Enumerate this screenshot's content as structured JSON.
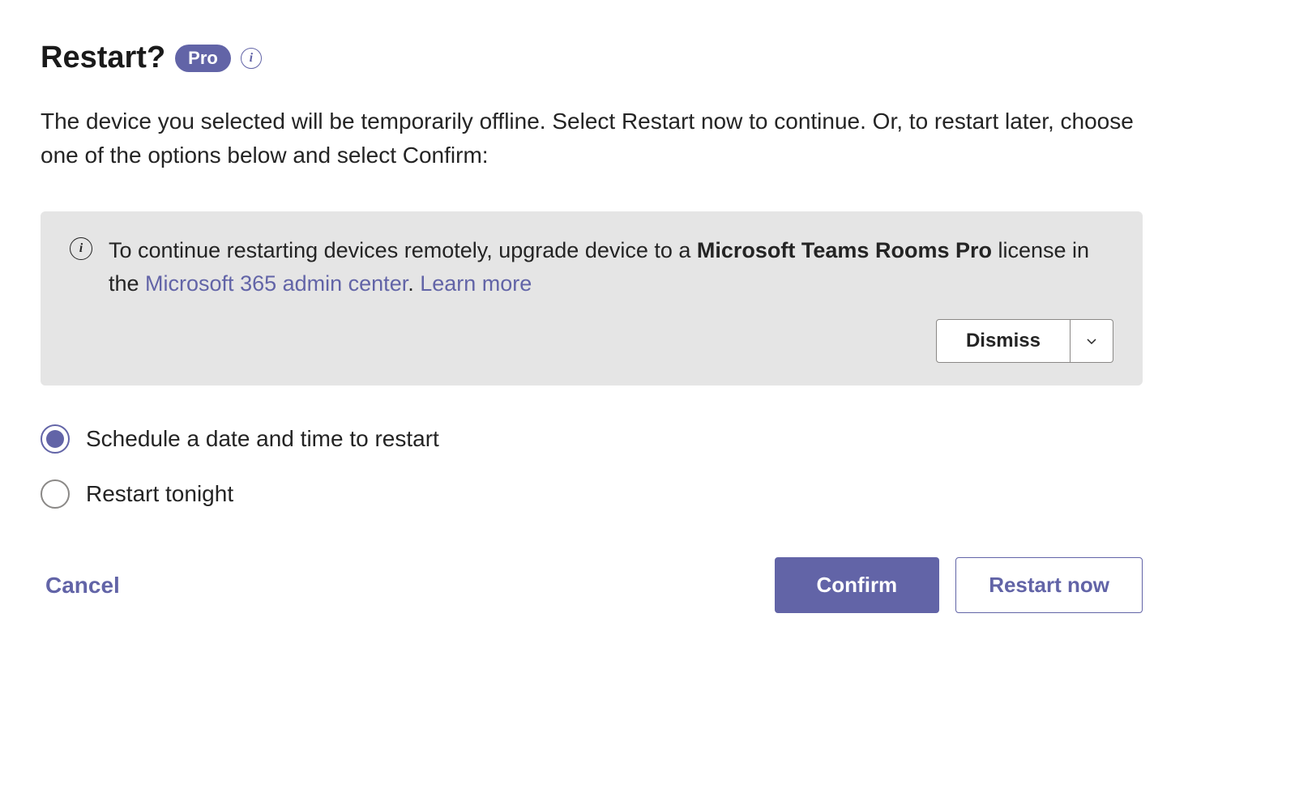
{
  "header": {
    "title": "Restart?",
    "badge": "Pro"
  },
  "description": "The device you selected will be temporarily offline. Select Restart now to continue. Or, to restart later, choose one of the options below and select Confirm:",
  "banner": {
    "text_prefix": "To continue restarting devices remotely, upgrade device to a ",
    "text_bold": "Microsoft Teams Rooms Pro",
    "text_middle": " license in the ",
    "link_admin": "Microsoft 365 admin center",
    "text_period": ". ",
    "link_learn": "Learn more",
    "dismiss_label": "Dismiss"
  },
  "options": {
    "schedule": "Schedule a date and time to restart",
    "tonight": "Restart tonight"
  },
  "footer": {
    "cancel": "Cancel",
    "confirm": "Confirm",
    "restart_now": "Restart now"
  },
  "colors": {
    "accent": "#6264A7",
    "banner_bg": "#e5e5e5"
  }
}
